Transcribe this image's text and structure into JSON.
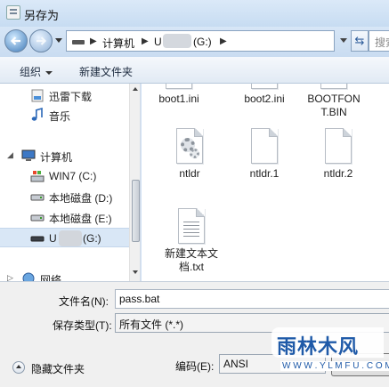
{
  "window": {
    "title": "另存为"
  },
  "address": {
    "segments": [
      "计算机",
      "U",
      "(G:)"
    ],
    "search_placeholder": "搜索"
  },
  "toolbar": {
    "organize_label": "组织",
    "new_folder_label": "新建文件夹"
  },
  "navpane": {
    "items": [
      {
        "label": "迅雷下载",
        "icon": "download-folder-icon"
      },
      {
        "label": "音乐",
        "icon": "music-icon"
      },
      {
        "label": "计算机",
        "icon": "computer-icon"
      },
      {
        "label": "WIN7 (C:)",
        "icon": "system-drive-icon"
      },
      {
        "label": "本地磁盘 (D:)",
        "icon": "drive-icon"
      },
      {
        "label": "本地磁盘 (E:)",
        "icon": "drive-icon"
      },
      {
        "label": "U",
        "label_suffix": "(G:)",
        "icon": "usb-drive-icon",
        "selected": true
      },
      {
        "label": "网络",
        "icon": "network-icon"
      }
    ]
  },
  "files": [
    {
      "name": "boot1.ini",
      "type": "text"
    },
    {
      "name": "boot2.ini",
      "type": "text"
    },
    {
      "name": "BOOTFON\nT.BIN",
      "type": "text"
    },
    {
      "name": "ntldr",
      "type": "system"
    },
    {
      "name": "ntldr.1",
      "type": "blank"
    },
    {
      "name": "ntldr.2",
      "type": "blank"
    },
    {
      "name": "新建文本文\n档.txt",
      "type": "text"
    }
  ],
  "form": {
    "filename_label": "文件名(N):",
    "filename_value": "pass.bat",
    "filetype_label": "保存类型(T):",
    "filetype_value": "所有文件  (*.*)",
    "encoding_label": "编码(E):",
    "encoding_value": "ANSI",
    "hide_folders_label": "隐藏文件夹"
  },
  "watermark": {
    "text": "雨林木风",
    "url": "W W W . Y L M F U . C O M"
  }
}
